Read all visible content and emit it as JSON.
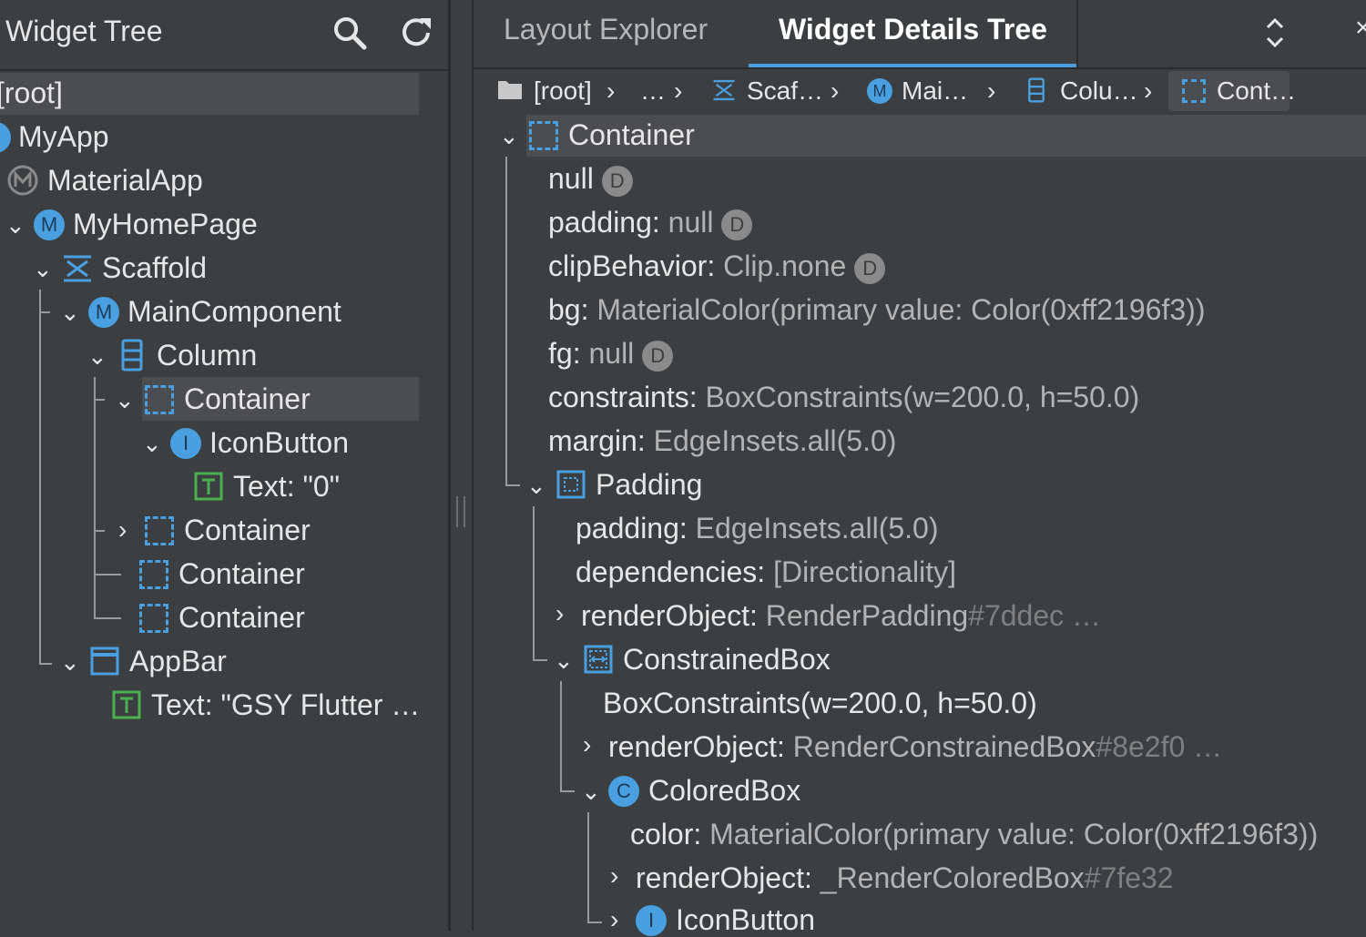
{
  "left": {
    "title": "Widget Tree",
    "tree": [
      {
        "label": "[root]"
      },
      {
        "label": "MyApp",
        "badge": "I"
      },
      {
        "label": "MaterialApp"
      },
      {
        "label": "MyHomePage",
        "badge": "M"
      },
      {
        "label": "Scaffold"
      },
      {
        "label": "MainComponent",
        "badge": "M"
      },
      {
        "label": "Column"
      },
      {
        "label": "Container"
      },
      {
        "label": "IconButton",
        "badge": "I"
      },
      {
        "label": "Text: \"0\""
      },
      {
        "label": "Container"
      },
      {
        "label": "Container"
      },
      {
        "label": "Container"
      },
      {
        "label": "AppBar"
      },
      {
        "label": "Text: \"GSY Flutter …"
      }
    ]
  },
  "right": {
    "tabs": [
      {
        "label": "Layout Explorer"
      },
      {
        "label": "Widget Details Tree"
      }
    ],
    "breadcrumb": [
      {
        "label": "[root]"
      },
      {
        "label": "…"
      },
      {
        "label": "Scaf…"
      },
      {
        "label": "Mai…",
        "badge": "M"
      },
      {
        "label": "Colu…"
      },
      {
        "label": "Cont…"
      }
    ],
    "rows": [
      {
        "name": "Container"
      },
      {
        "name": "null",
        "badge": "D"
      },
      {
        "name": "padding: ",
        "value": "null",
        "badge": "D"
      },
      {
        "name": "clipBehavior: ",
        "value": "Clip.none",
        "badge": "D"
      },
      {
        "name": "bg: ",
        "value": "MaterialColor(primary value: Color(0xff2196f3))"
      },
      {
        "name": "fg: ",
        "value": "null",
        "badge": "D"
      },
      {
        "name": "constraints: ",
        "value": "BoxConstraints(w=200.0, h=50.0)"
      },
      {
        "name": "margin: ",
        "value": "EdgeInsets.all(5.0)"
      },
      {
        "name": "Padding"
      },
      {
        "name": "padding: ",
        "value": "EdgeInsets.all(5.0)"
      },
      {
        "name": "dependencies: ",
        "value": "[Directionality]"
      },
      {
        "name": "renderObject: ",
        "value": "RenderPadding",
        "hash": "#7ddec",
        "tail": " …"
      },
      {
        "name": "ConstrainedBox"
      },
      {
        "name": "BoxConstraints(w=200.0, h=50.0)"
      },
      {
        "name": "renderObject: ",
        "value": "RenderConstrainedBox",
        "hash": "#8e2f0",
        "tail": " …"
      },
      {
        "name": "ColoredBox",
        "badge": "C"
      },
      {
        "name": "color: ",
        "value": "MaterialColor(primary value: Color(0xff2196f3))"
      },
      {
        "name": "renderObject: ",
        "value": "_RenderColoredBox",
        "hash": "#7fe32"
      },
      {
        "name": "IconButton",
        "badge": "I"
      }
    ]
  },
  "colors": {
    "accent": "#4a9fe0",
    "text_icon": "#4caf50",
    "background": "#3c3f41"
  }
}
